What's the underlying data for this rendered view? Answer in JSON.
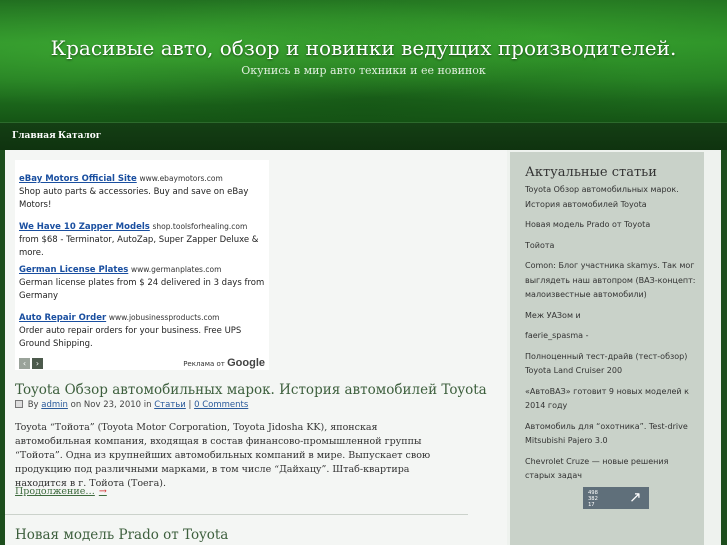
{
  "header": {
    "title": "Красивые авто, обзор и новинки ведущих производителей.",
    "tagline": "Окунись в мир авто техники и ее новинок"
  },
  "nav": {
    "items": [
      "Главная",
      "Каталог"
    ]
  },
  "ads": {
    "items": [
      {
        "title": "eBay Motors Official Site",
        "url": "www.ebaymotors.com",
        "text": "Shop auto parts & accessories. Buy and save on eBay Motors!"
      },
      {
        "title": "We Have 10 Zapper Models",
        "url": "shop.toolsforhealing.com",
        "text": "from $68 - Terminator, AutoZap, Super Zapper Deluxe & more."
      },
      {
        "title": "German License Plates",
        "url": "www.germanplates.com",
        "text": "German license plates from $ 24 delivered in 3 days from Germany"
      },
      {
        "title": "Auto Repair Order",
        "url": "www.jobusinessproducts.com",
        "text": "Order auto repair orders for your business. Free UPS Ground Shipping."
      }
    ],
    "prev_icon": "‹",
    "next_icon": "›",
    "credit_prefix": "Реклама от",
    "credit_brand": "Google"
  },
  "posts": [
    {
      "title": "Toyota Обзор автомобильных марок. История автомобилей Toyota",
      "by": "By",
      "author": "admin",
      "on": "on Nov 23, 2010 in",
      "category": "Статьи",
      "sep": "|",
      "comments": "0 Comments",
      "excerpt": "Toyota “Тойота” (Toyota Motor Corporation, Toyota Jidosha KK), японская автомобильная компания, входящая в состав финансово-промышленной группы “Тойота”. Одна из крупнейших автомобильных компаний в мире. Выпускает свою продукцию под различными марками, в том числе “Дайхацу”. Штаб-квартира находится в г. Тойота (Тоега).",
      "more": "Продолжение…",
      "more_icon": "→"
    },
    {
      "title": "Новая модель Prado от Toyota"
    }
  ],
  "sidebar": {
    "heading": "Актуальные статьи",
    "items": [
      "Toyota Обзор автомобильных марок. История автомобилей Toyota",
      "Новая модель Prado от Toyota",
      "Тойота",
      "Comon: Блог участника skamys. Так мог выглядеть наш автопром (ВАЗ-концепт: малоизвестные автомобили)",
      "Меж УАЗом и",
      "faerie_spasma -",
      "Полноценный тест-драйв (тест-обзор) Toyota Land Cruiser 200",
      "«АвтоВАЗ» готовит 9 новых моделей к 2014 году",
      "Автомобиль для “охотника”. Test-drive Mitsubishi Pajero 3.0",
      "Chevrolet Cruze — новые решения старых задач"
    ],
    "counter": {
      "lines": [
        "498",
        "382",
        "17"
      ],
      "icon": "↗"
    }
  }
}
